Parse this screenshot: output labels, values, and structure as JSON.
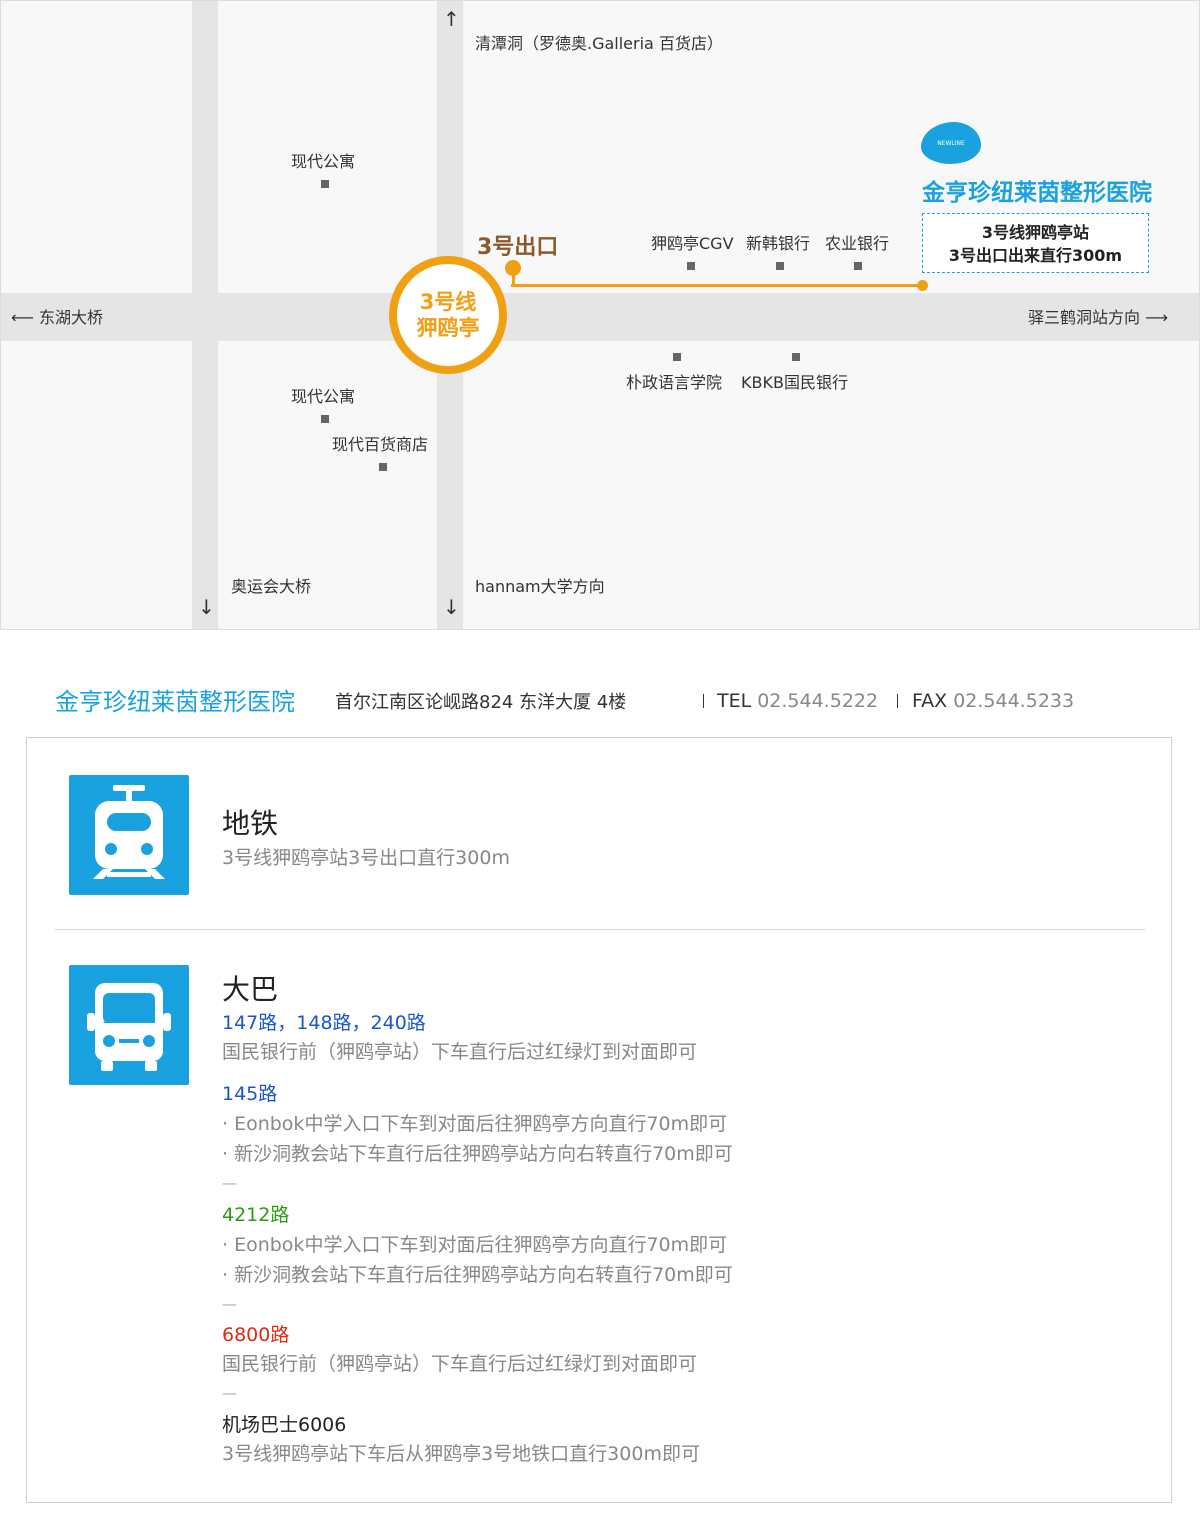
{
  "map": {
    "north_label": "清潭洞（罗德奥.Galleria 百货店）",
    "west_label": "东湖大桥",
    "east_label": "驿三鹤洞站方向",
    "south_left_label": "奥运会大桥",
    "south_right_label": "hannam大学方向",
    "station_line": "3号线",
    "station_name": "狎鸥亭",
    "exit_label": "3号出口",
    "landmarks": {
      "apt_top": "现代公寓",
      "apt_bottom": "现代公寓",
      "dept_store": "现代百货商店",
      "cgv": "狎鸥亭CGV",
      "shinhan": "新韩银行",
      "nonghyup": "农业银行",
      "park": "朴政语言学院",
      "kbkb": "KBKB国民银行"
    },
    "clinic_name": "金亨珍纽莱茵整形医院",
    "clinic_logo_text": "NEWLINE",
    "dir_line1": "3号线狎鸥亭站",
    "dir_line2": "3号出口出来直行300m",
    "colors": {
      "route": "#f0a013",
      "brand": "#1aa2e0"
    }
  },
  "info": {
    "name": "金亨珍纽莱茵整形医院",
    "address": "首尔江南区论岘路824 东洋大厦 4楼",
    "tel_label": "TEL",
    "tel": "02.544.5222",
    "fax_label": "FAX",
    "fax": "02.544.5233"
  },
  "subway": {
    "title": "地铁",
    "desc": "3号线狎鸥亭站3号出口直行300m"
  },
  "bus": {
    "title": "大巴",
    "r1_name": "147路，148路，240路",
    "r1_desc": "国民银行前（狎鸥亭站）下车直行后过红绿灯到对面即可",
    "r2_name": "145路",
    "r2_desc1": "· Eonbok中学入口下车到对面后往狎鸥亭方向直行70m即可",
    "r2_desc2": "· 新沙洞教会站下车直行后往狎鸥亭站方向右转直行70m即可",
    "sep": "—",
    "r3_name": "4212路",
    "r3_desc1": "· Eonbok中学入口下车到对面后往狎鸥亭方向直行70m即可",
    "r3_desc2": "· 新沙洞教会站下车直行后往狎鸥亭站方向右转直行70m即可",
    "r4_name": "6800路",
    "r4_desc": "国民银行前（狎鸥亭站）下车直行后过红绿灯到对面即可",
    "r5_name": "机场巴士6006",
    "r5_desc": "3号线狎鸥亭站下车后从狎鸥亭3号地铁口直行300m即可",
    "colors": {
      "blue": "#1a56c8",
      "green": "#2a9e12",
      "red": "#e02a10",
      "dark": "#222222"
    }
  }
}
